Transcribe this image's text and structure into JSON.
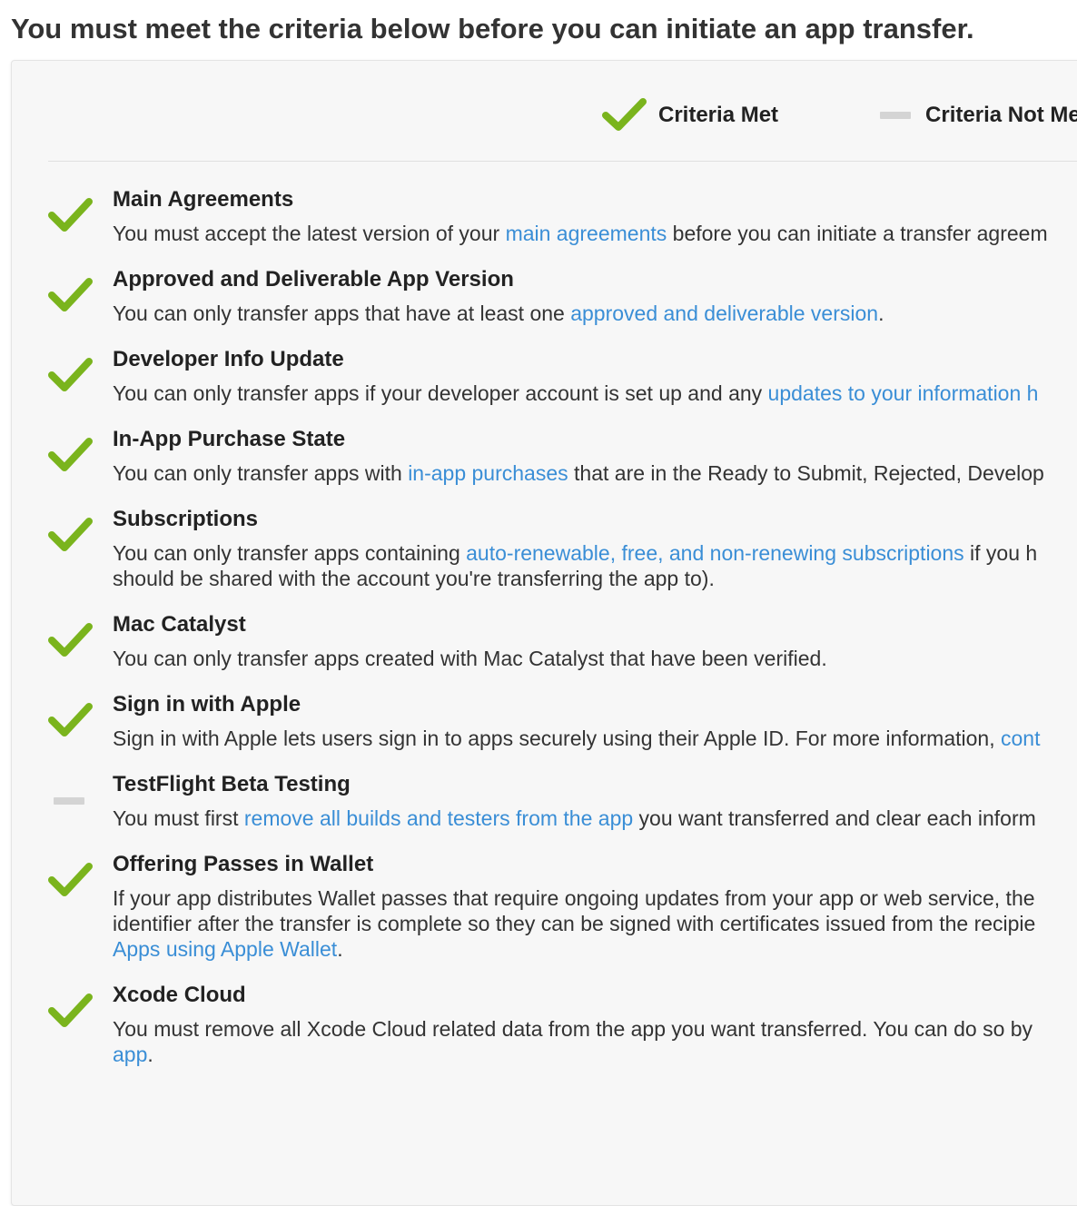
{
  "page": {
    "heading": "You must meet the criteria below before you can initiate an app transfer."
  },
  "legend": {
    "met_label": "Criteria Met",
    "not_met_label": "Criteria Not Me"
  },
  "colors": {
    "check_green": "#7ab41d",
    "not_met_gray": "#d4d4d4",
    "link_blue": "#3a8ed6"
  },
  "icons": {
    "met": "check-icon",
    "not_met": "dash-icon"
  },
  "criteria": [
    {
      "id": "main-agreements",
      "status": "met",
      "title": "Main Agreements",
      "lines": [
        [
          {
            "text": "You must accept the latest version of your "
          },
          {
            "text": "main agreements",
            "link": true
          },
          {
            "text": " before you can initiate a transfer agreem"
          }
        ]
      ]
    },
    {
      "id": "approved-version",
      "status": "met",
      "title": "Approved and Deliverable App Version",
      "lines": [
        [
          {
            "text": "You can only transfer apps that have at least one "
          },
          {
            "text": "approved and deliverable version",
            "link": true
          },
          {
            "text": "."
          }
        ]
      ]
    },
    {
      "id": "developer-info",
      "status": "met",
      "title": "Developer Info Update",
      "lines": [
        [
          {
            "text": "You can only transfer apps if your developer account is set up and any "
          },
          {
            "text": "updates to your information h",
            "link": true
          }
        ]
      ]
    },
    {
      "id": "iap-state",
      "status": "met",
      "title": "In-App Purchase State",
      "lines": [
        [
          {
            "text": "You can only transfer apps with "
          },
          {
            "text": "in-app purchases",
            "link": true
          },
          {
            "text": " that are in the Ready to Submit, Rejected, Develop"
          }
        ]
      ]
    },
    {
      "id": "subscriptions",
      "status": "met",
      "title": "Subscriptions",
      "lines": [
        [
          {
            "text": "You can only transfer apps containing "
          },
          {
            "text": "auto-renewable, free, and non-renewing subscriptions",
            "link": true
          },
          {
            "text": " if you h"
          }
        ],
        [
          {
            "text": "should be shared with the account you're transferring the app to)."
          }
        ]
      ]
    },
    {
      "id": "mac-catalyst",
      "status": "met",
      "title": "Mac Catalyst",
      "lines": [
        [
          {
            "text": "You can only transfer apps created with Mac Catalyst that have been verified."
          }
        ]
      ]
    },
    {
      "id": "sign-in-with-apple",
      "status": "met",
      "title": "Sign in with Apple",
      "lines": [
        [
          {
            "text": "Sign in with Apple lets users sign in to apps securely using their Apple ID. For more information, "
          },
          {
            "text": "cont",
            "link": true
          }
        ]
      ]
    },
    {
      "id": "testflight",
      "status": "not_met",
      "title": "TestFlight Beta Testing",
      "lines": [
        [
          {
            "text": "You must first "
          },
          {
            "text": "remove all builds and testers from the app",
            "link": true
          },
          {
            "text": " you want transferred and clear each inform"
          }
        ]
      ]
    },
    {
      "id": "wallet-passes",
      "status": "met",
      "title": "Offering Passes in Wallet",
      "lines": [
        [
          {
            "text": "If your app distributes Wallet passes that require ongoing updates from your app or web service, the"
          }
        ],
        [
          {
            "text": "identifier after the transfer is complete so they can be signed with certificates issued from the recipie"
          }
        ],
        [
          {
            "text": "Apps using Apple Wallet",
            "link": true
          },
          {
            "text": "."
          }
        ]
      ]
    },
    {
      "id": "xcode-cloud",
      "status": "met",
      "title": "Xcode Cloud",
      "lines": [
        [
          {
            "text": "You must remove all Xcode Cloud related data from the app you want transferred. You can do so by"
          }
        ],
        [
          {
            "text": "app",
            "link": true
          },
          {
            "text": "."
          }
        ]
      ]
    }
  ]
}
